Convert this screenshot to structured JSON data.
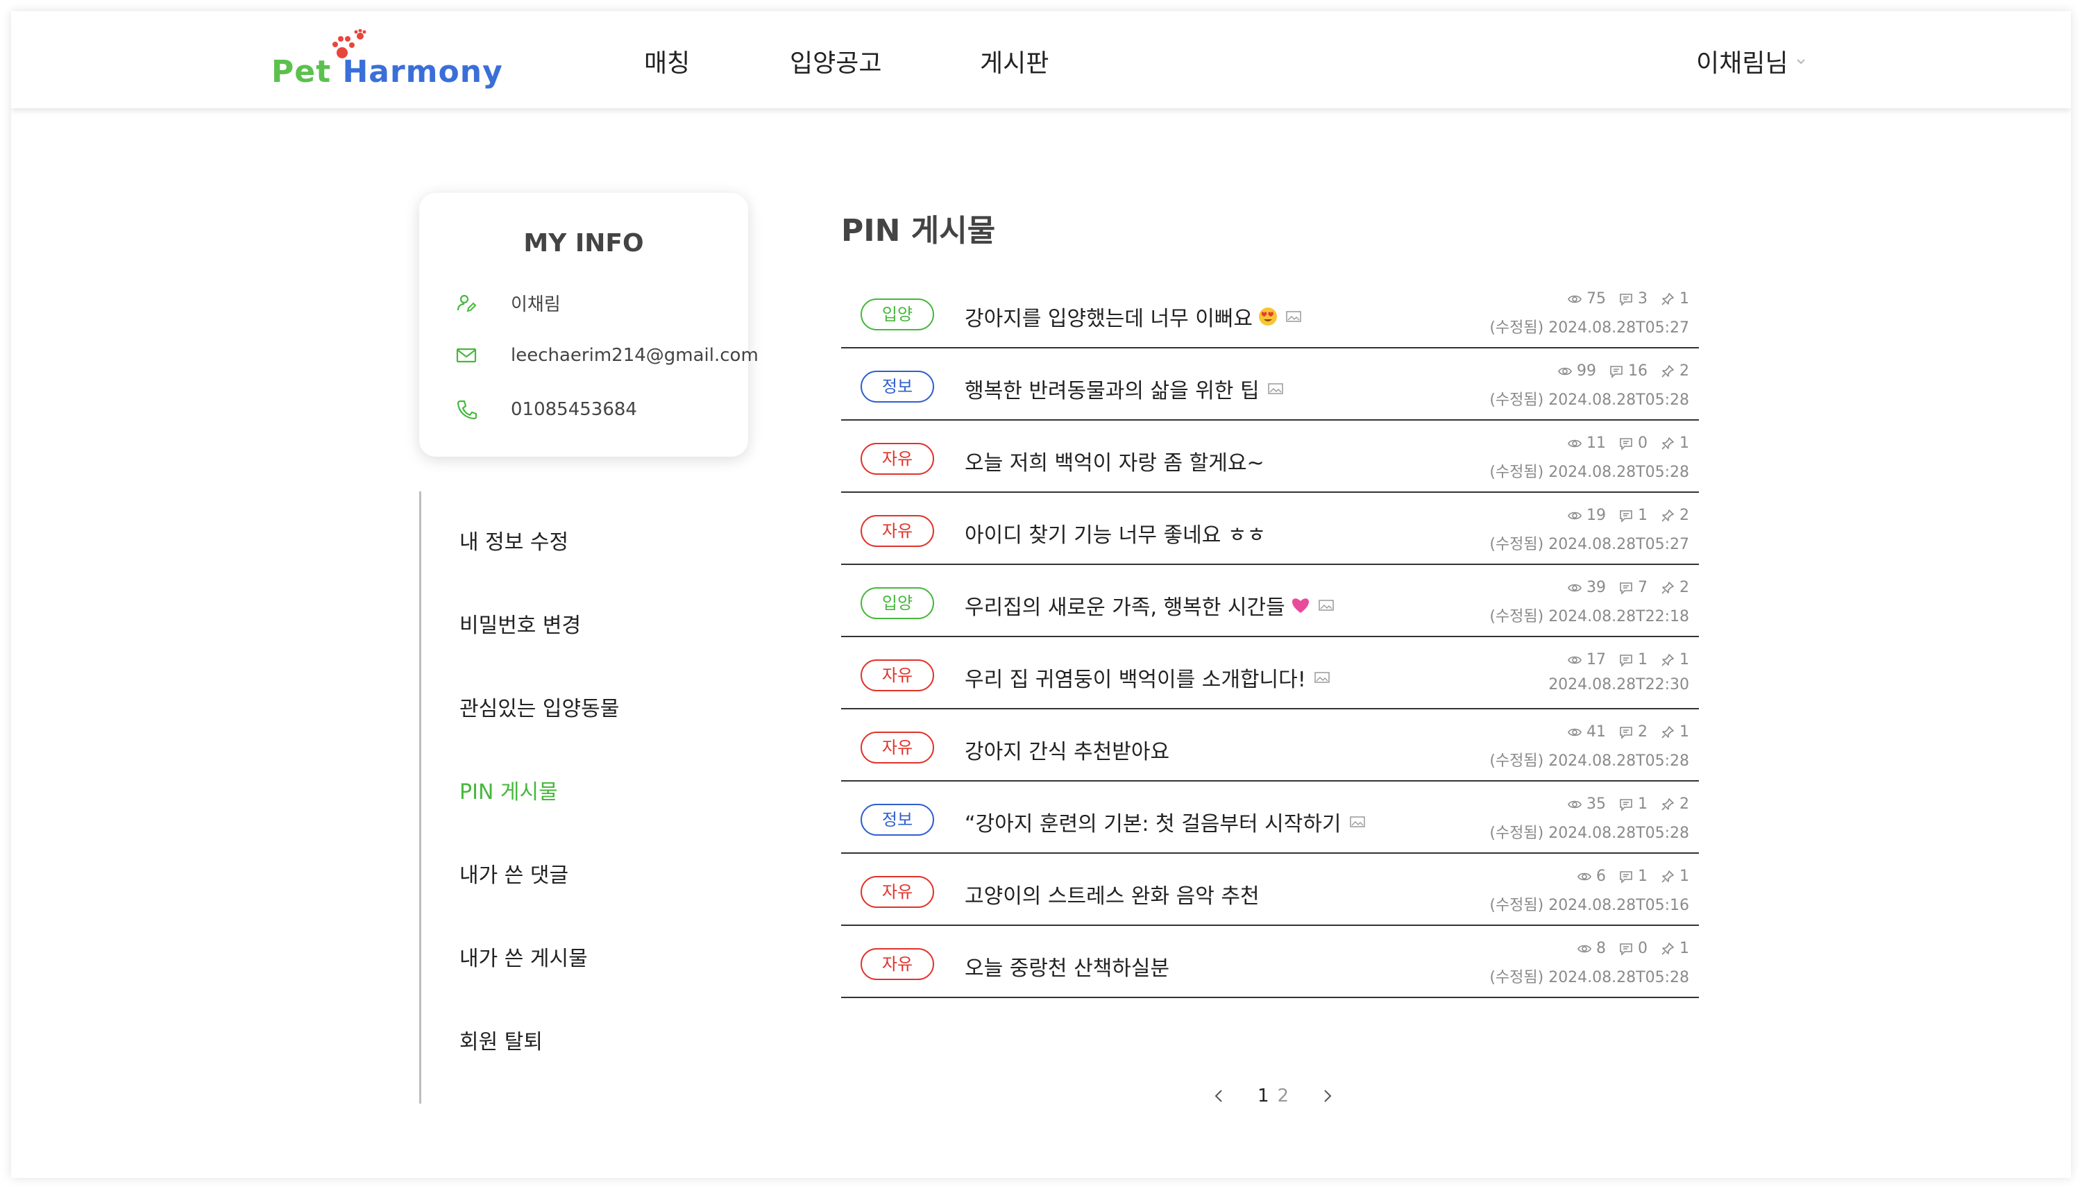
{
  "header": {
    "logo": {
      "word1": "Pet",
      "word2": "Harmony"
    },
    "nav": [
      "매칭",
      "입양공고",
      "게시판"
    ],
    "user_name": "이채림님"
  },
  "profile": {
    "title": "MY INFO",
    "name": "이채림",
    "email": "leechaerim214@gmail.com",
    "phone": "01085453684"
  },
  "side_menu": [
    {
      "label": "내 정보 수정"
    },
    {
      "label": "비밀번호 변경"
    },
    {
      "label": "관심있는 입양동물"
    },
    {
      "label": "PIN 게시물",
      "active": true
    },
    {
      "label": "내가 쓴 댓글"
    },
    {
      "label": "내가 쓴 게시물"
    },
    {
      "label": "회원 탈퇴"
    }
  ],
  "board": {
    "title": "PIN 게시물",
    "posts": [
      {
        "category": "입양",
        "type": "adopt",
        "title": "강아지를 입양했는데 너무 이뻐요",
        "emoji": "heart-eyes",
        "has_image": true,
        "views": "75",
        "comments": "3",
        "pins": "1",
        "date": "(수정됨) 2024.08.28T05:27"
      },
      {
        "category": "정보",
        "type": "info",
        "title": "행복한 반려동물과의 삶을 위한 팁",
        "emoji": "",
        "has_image": true,
        "views": "99",
        "comments": "16",
        "pins": "2",
        "date": "(수정됨) 2024.08.28T05:28"
      },
      {
        "category": "자유",
        "type": "free",
        "title": "오늘 저희 백억이 자랑 좀 할게요~",
        "emoji": "",
        "has_image": false,
        "views": "11",
        "comments": "0",
        "pins": "1",
        "date": "(수정됨) 2024.08.28T05:28"
      },
      {
        "category": "자유",
        "type": "free",
        "title": "아이디 찾기 기능 너무 좋네요 ㅎㅎ",
        "emoji": "",
        "has_image": false,
        "views": "19",
        "comments": "1",
        "pins": "2",
        "date": "(수정됨) 2024.08.28T05:27"
      },
      {
        "category": "입양",
        "type": "adopt",
        "title": "우리집의 새로운 가족, 행복한 시간들",
        "emoji": "pink-heart",
        "has_image": true,
        "views": "39",
        "comments": "7",
        "pins": "2",
        "date": "(수정됨) 2024.08.28T22:18"
      },
      {
        "category": "자유",
        "type": "free",
        "title": "우리 집 귀염둥이 백억이를 소개합니다!",
        "emoji": "",
        "has_image": true,
        "views": "17",
        "comments": "1",
        "pins": "1",
        "date": "2024.08.28T22:30"
      },
      {
        "category": "자유",
        "type": "free",
        "title": "강아지 간식 추천받아요",
        "emoji": "",
        "has_image": false,
        "views": "41",
        "comments": "2",
        "pins": "1",
        "date": "(수정됨) 2024.08.28T05:28"
      },
      {
        "category": "정보",
        "type": "info",
        "title": "“강아지 훈련의 기본: 첫 걸음부터 시작하기",
        "emoji": "",
        "has_image": true,
        "views": "35",
        "comments": "1",
        "pins": "2",
        "date": "(수정됨) 2024.08.28T05:28"
      },
      {
        "category": "자유",
        "type": "free",
        "title": "고양이의 스트레스 완화 음악 추천",
        "emoji": "",
        "has_image": false,
        "views": "6",
        "comments": "1",
        "pins": "1",
        "date": "(수정됨) 2024.08.28T05:16"
      },
      {
        "category": "자유",
        "type": "free",
        "title": "오늘 중랑천 산책하실분",
        "emoji": "",
        "has_image": false,
        "views": "8",
        "comments": "0",
        "pins": "1",
        "date": "(수정됨) 2024.08.28T05:28"
      }
    ]
  },
  "pagination": {
    "pages": [
      "1",
      "2"
    ],
    "current": "1"
  },
  "colors": {
    "green": "#46b83c",
    "blue": "#2f5fcf",
    "red": "#e0332b",
    "text": "#222222",
    "muted": "#8a8a8a"
  }
}
